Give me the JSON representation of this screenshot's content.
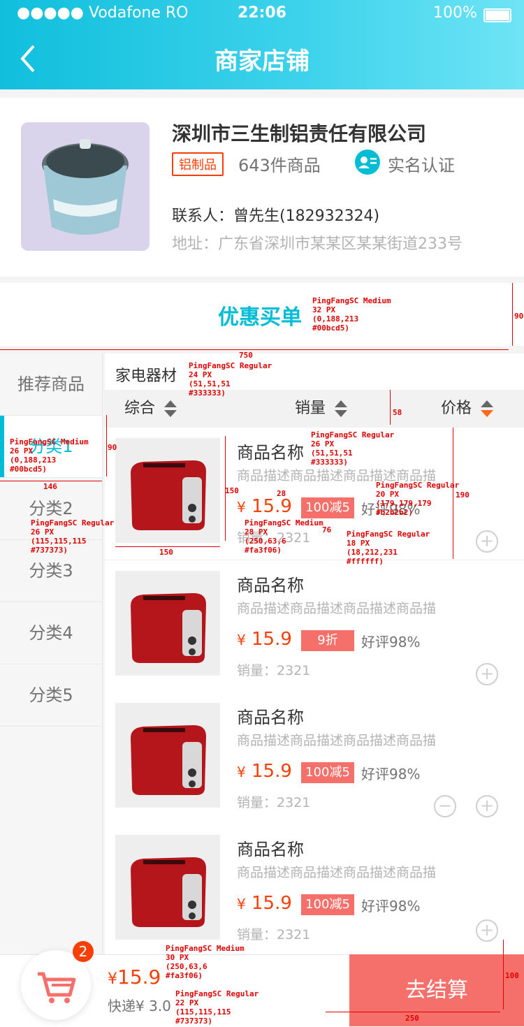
{
  "status": {
    "carrier": "●●●●● Vodafone RO",
    "time": "22:06",
    "battery": "100%"
  },
  "header": {
    "title": "商家店铺"
  },
  "shop": {
    "name": "深圳市三生制铝责任有限公司",
    "tag": "铝制品",
    "count": "643件商品",
    "verified": "实名认证",
    "contact": "联系人：曾先生(182932324)",
    "address": "地址：广东省深圳市某某区某某街道233号"
  },
  "coupon": {
    "label": "优惠买单"
  },
  "sidebar": {
    "items": [
      {
        "label": "推荐商品"
      },
      {
        "label": "分类1"
      },
      {
        "label": "分类2"
      },
      {
        "label": "分类3"
      },
      {
        "label": "分类4"
      },
      {
        "label": "分类5"
      }
    ]
  },
  "main": {
    "category_title": "家电器材",
    "sort": {
      "overall": "综合",
      "sales": "销量",
      "price": "价格"
    },
    "products": [
      {
        "name": "商品名称",
        "desc": "商品描述商品描述商品描述商品描",
        "price_symbol": "¥",
        "price": "15.9",
        "badge": "100减5",
        "rating": "好评98%",
        "sales": "销量：2321"
      },
      {
        "name": "商品名称",
        "desc": "商品描述商品描述商品描述商品描",
        "price_symbol": "¥",
        "price": "15.9",
        "badge": "9折",
        "rating": "好评98%",
        "sales": "销量：2321"
      },
      {
        "name": "商品名称",
        "desc": "商品描述商品描述商品描述商品描",
        "price_symbol": "¥",
        "price": "15.9",
        "badge": "100减5",
        "rating": "好评98%",
        "sales": "销量：2321"
      },
      {
        "name": "商品名称",
        "desc": "商品描述商品描述商品描述商品描",
        "price_symbol": "¥",
        "price": "15.9",
        "badge": "100减5",
        "rating": "好评98%",
        "sales": "销量：2321"
      }
    ]
  },
  "cart": {
    "badge": "2",
    "total_symbol": "¥",
    "total": "15.9",
    "shipping": "快递¥ 3.0",
    "checkout": "去结算"
  },
  "annotations": {
    "coupon_font": "PingFangSC Medium\n32 PX\n(0,188,213\n#00bcd5)",
    "coupon_height": "90",
    "width_750": "750",
    "cat_title_font": "PingFangSC Regular\n24 PX\n(51,51,51\n#333333)",
    "sort_height": "58",
    "active_font": "PingFangSC Medium\n26 PX\n(0,188,213\n#00bcd5)",
    "sidebar_row": "90",
    "sidebar_width": "146",
    "inactive_font": "PingFangSC Regular\n26 PX\n(115,115,115\n#737373)",
    "name_font": "PingFangSC Regular\n26 PX\n(51,51,51\n#333333)",
    "desc_font": "PingFangSC Regular\n20 PX\n(179,179,179\n#b2b2b2)",
    "row_height": "190",
    "img_height": "150",
    "img_width": "150",
    "gap_28": "28",
    "price_font": "PingFangSC Medium\n28 PX\n(250,63,6\n#fa3f06)",
    "badge_width": "76",
    "badge_font": "PingFangSC Regular\n18 PX\n(18,212,231\n#ffffff)",
    "total_font": "PingFangSC Medium\n30 PX\n(250,63,6\n#fa3f06)",
    "ship_font": "PingFangSC Regular\n22 PX\n(115,115,115\n#737373)",
    "checkout_height": "100",
    "checkout_width": "250"
  },
  "colors": {
    "accent": "#00bcd5",
    "price": "#fa3f06",
    "badge": "#f5706a",
    "muted": "#737373"
  }
}
